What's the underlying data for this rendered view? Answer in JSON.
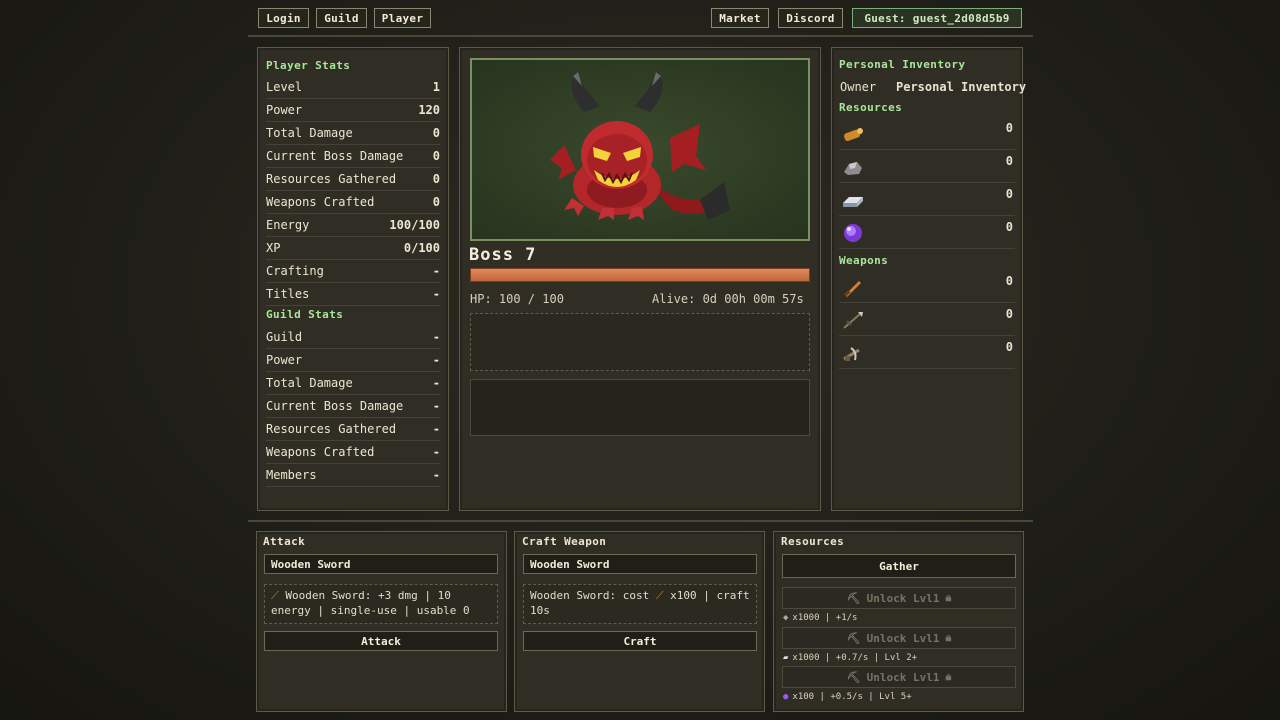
{
  "nav": {
    "login": "Login",
    "guild": "Guild",
    "player": "Player",
    "market": "Market",
    "discord": "Discord",
    "guest": "Guest: guest_2d08d5b9"
  },
  "player_stats": {
    "title": "Player Stats",
    "rows": [
      {
        "label": "Level",
        "value": "1"
      },
      {
        "label": "Power",
        "value": "120"
      },
      {
        "label": "Total Damage",
        "value": "0"
      },
      {
        "label": "Current Boss Damage",
        "value": "0"
      },
      {
        "label": "Resources Gathered",
        "value": "0"
      },
      {
        "label": "Weapons Crafted",
        "value": "0"
      },
      {
        "label": "Energy",
        "value": "100/100"
      },
      {
        "label": "XP",
        "value": "0/100"
      },
      {
        "label": "Crafting",
        "value": "-"
      },
      {
        "label": "Titles",
        "value": "-"
      }
    ]
  },
  "guild_stats": {
    "title": "Guild Stats",
    "rows": [
      {
        "label": "Guild",
        "value": "-"
      },
      {
        "label": "Power",
        "value": "-"
      },
      {
        "label": "Total Damage",
        "value": "-"
      },
      {
        "label": "Current Boss Damage",
        "value": "-"
      },
      {
        "label": "Resources Gathered",
        "value": "-"
      },
      {
        "label": "Weapons Crafted",
        "value": "-"
      },
      {
        "label": "Members",
        "value": "-"
      }
    ]
  },
  "boss": {
    "name": "Boss 7",
    "hp_text": "HP: 100 / 100",
    "alive_text": "Alive: 0d 00h 00m 57s",
    "hp_fraction": 1.0
  },
  "inventory": {
    "title": "Personal Inventory",
    "owner_label": "Owner",
    "owner_value": "Personal Inventory",
    "resources_title": "Resources",
    "resources": [
      {
        "icon": "wood-log-icon",
        "count": "0"
      },
      {
        "icon": "stone-ore-icon",
        "count": "0"
      },
      {
        "icon": "iron-ingot-icon",
        "count": "0"
      },
      {
        "icon": "purple-gem-icon",
        "count": "0"
      }
    ],
    "weapons_title": "Weapons",
    "weapons": [
      {
        "icon": "wooden-sword-icon",
        "count": "0"
      },
      {
        "icon": "spear-icon",
        "count": "0"
      },
      {
        "icon": "crossbow-icon",
        "count": "0"
      }
    ]
  },
  "attack": {
    "title": "Attack",
    "selected": "Wooden Sword",
    "info": "Wooden Sword: +3 dmg | 10 energy | single-use | usable 0",
    "button": "Attack"
  },
  "craft": {
    "title": "Craft Weapon",
    "selected": "Wooden Sword",
    "info_prefix": "Wooden Sword: cost",
    "info_suffix": "x100 | craft 10s",
    "button": "Craft"
  },
  "resources_panel": {
    "title": "Resources",
    "gather": "Gather",
    "unlocks": [
      {
        "label": "Unlock Lvl1",
        "info": "x1000 | +1/s"
      },
      {
        "label": "Unlock Lvl1",
        "info": "x1000 | +0.7/s | Lvl 2+"
      },
      {
        "label": "Unlock Lvl1",
        "info": "x100 | +0.5/s | Lvl 5+"
      }
    ]
  },
  "colors": {
    "accent_green": "#a8e69a",
    "hp_bar": "#c86a3f",
    "panel_bg": "#302e24"
  }
}
